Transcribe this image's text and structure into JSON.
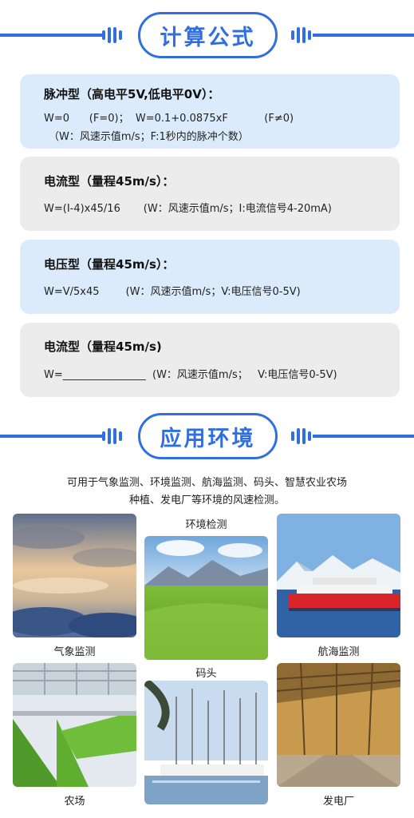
{
  "sections": {
    "formulas_title": "计算公式",
    "environment_title": "应用环境"
  },
  "formulas": [
    {
      "title": "脉冲型（高电平5V,低电平0V）：",
      "lines": [
        "W=0      (F=0)；  W=0.1+0.0875xF           (F≠0)",
        "（W：风速示值m/s；F:1秒内的脉冲个数）"
      ]
    },
    {
      "title": "电流型（量程45m/s）：",
      "lines": [
        "W=(I-4)x45/16       (W：风速示值m/s；I:电流信号4-20mA)"
      ]
    },
    {
      "title": "电压型（量程45m/s）：",
      "lines": [
        "W=V/5x45        (W：风速示值m/s；V:电压信号0-5V)"
      ]
    },
    {
      "title": "电流型（量程45m/s)",
      "lines": [
        "W=________________  (W：风速示值m/s；   V:电压信号0-5V)"
      ]
    }
  ],
  "intro": {
    "line1": "可用于气象监测、环境监测、航海监测、码头、智慧农业农场",
    "line2": "种植、发电厂等环境的风速检测。"
  },
  "scenes": {
    "weather": "气象监测",
    "environment": "环境检测",
    "marine": "航海监测",
    "dock": "码头",
    "farm": "农场",
    "power": "发电厂"
  },
  "colors": {
    "accent": "#2f6fe0",
    "card_blue": "#dcebfb",
    "card_gray": "#ececec"
  }
}
